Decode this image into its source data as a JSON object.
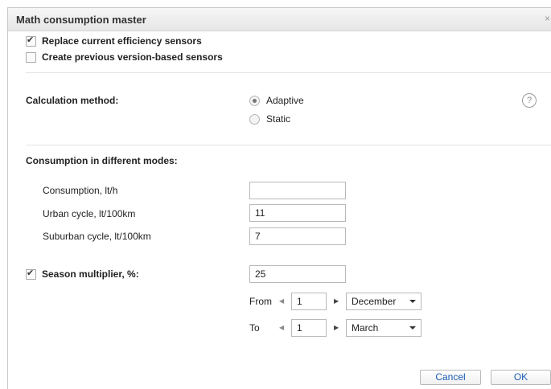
{
  "dialog": {
    "title": "Math consumption master",
    "close_glyph": "×"
  },
  "options": {
    "replace_sensors": {
      "label": "Replace current efficiency sensors",
      "checked": true
    },
    "create_previous": {
      "label": "Create previous version-based sensors",
      "checked": false
    }
  },
  "calculation": {
    "label": "Calculation method:",
    "methods": [
      {
        "label": "Adaptive",
        "selected": true
      },
      {
        "label": "Static",
        "selected": false
      }
    ],
    "help_glyph": "?"
  },
  "consumption": {
    "heading": "Consumption in different modes:",
    "fields": [
      {
        "label": "Consumption, lt/h",
        "value": ""
      },
      {
        "label": "Urban cycle, lt/100km",
        "value": "11"
      },
      {
        "label": "Suburban cycle, lt/100km",
        "value": "7"
      }
    ]
  },
  "season": {
    "label": "Season multiplier, %:",
    "checked": true,
    "value": "25",
    "from": {
      "label": "From",
      "day": "1",
      "month": "December"
    },
    "to": {
      "label": "To",
      "day": "1",
      "month": "March"
    }
  },
  "buttons": {
    "cancel": "Cancel",
    "ok": "OK"
  }
}
